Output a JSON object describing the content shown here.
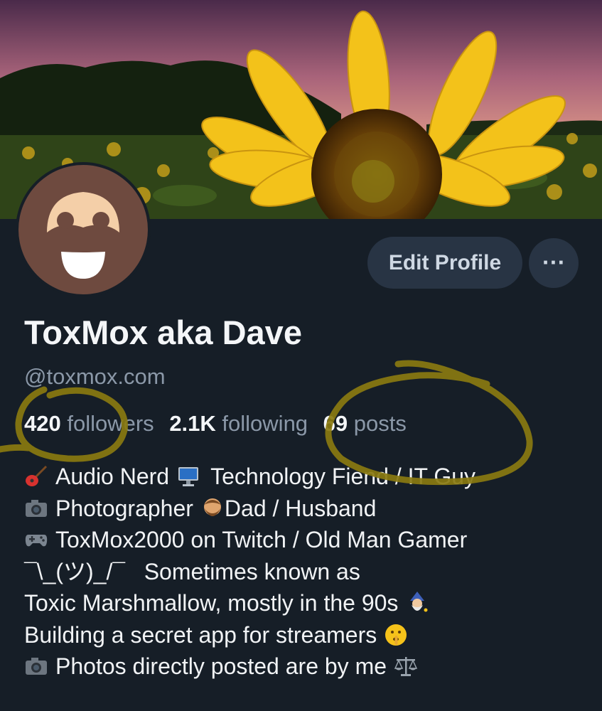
{
  "profile": {
    "display_name": "ToxMox aka Dave",
    "handle": "@toxmox.com",
    "edit_button_label": "Edit Profile",
    "more_button_label": "···"
  },
  "stats": {
    "followers_count": "420",
    "followers_label": "followers",
    "following_count": "2.1K",
    "following_label": "following",
    "posts_count": "69",
    "posts_label": "posts"
  },
  "bio": {
    "line1_a": "Audio Nerd",
    "line1_b": "Technology Fiend / IT Guy",
    "line2_a": "Photographer",
    "line2_b": "Dad / Husband",
    "line3": "ToxMox2000 on Twitch / Old Man Gamer",
    "line4": "¯\\_(ツ)_/¯   Sometimes known as",
    "line5": "Toxic Marshmallow, mostly in the 90s",
    "line6": "Building a secret app for streamers",
    "line7": "Photos directly posted are by me"
  },
  "icons": {
    "line1_a": "guitar-icon",
    "line1_b": "desktop-computer-icon",
    "line2_a": "camera-icon",
    "line2_b": "bearded-person-icon",
    "line3": "game-controller-icon",
    "line5": "wizard-icon",
    "line6": "shushing-face-icon",
    "line7_a": "camera-icon",
    "line7_b": "balance-scale-icon"
  },
  "colors": {
    "background": "#161e27",
    "muted_text": "#8b98a8",
    "button_bg": "#283444",
    "scribble": "#8a7a10"
  }
}
